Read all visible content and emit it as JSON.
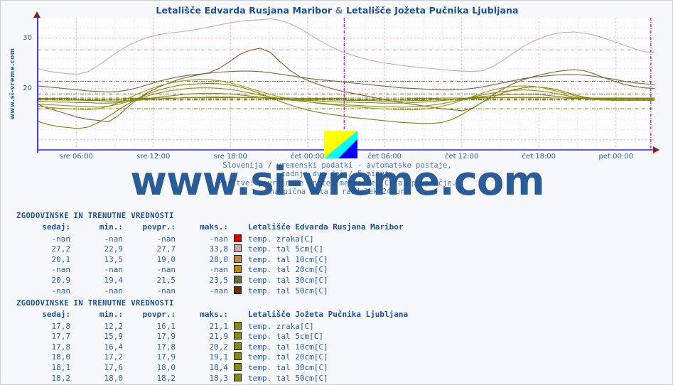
{
  "page": {
    "title": "Letališče Edvarda Rusjana Maribor & Letališče Jožeta Pučnika Ljubljana",
    "title_station_a": "Letališče Edvarda Rusjana Maribor",
    "title_amp": "&",
    "title_station_b": "Letališče Jožeta Pučnika Ljubljana",
    "vertical_url": "www.si-vreme.com",
    "watermark": "www.si-vreme.com",
    "background": "#f6f8fc",
    "accent": "#2a5fa8"
  },
  "caption": {
    "line1": "Slovenija / vremenski podatki - avtomatske postaje,",
    "line2": "zadnja dva dni / 5 minut.",
    "line3": "Meritve: površinske enote: metrične. Črta: povprečje.",
    "line4": "navpična črta - razdelek 24 ur"
  },
  "chart_data": {
    "type": "line",
    "title": "Letališče Edvarda Rusjana Maribor & Letališče Jožeta Pučnika Ljubljana",
    "xlabel": "",
    "ylabel": "",
    "ylim": [
      8,
      34
    ],
    "yticks": [
      20,
      30
    ],
    "ytick_labels": [
      "20",
      "30"
    ],
    "grid": true,
    "legend_position": "below-table",
    "x": [
      "sre 06:00",
      "sre 12:00",
      "sre 18:00",
      "čet 00:00",
      "čet 06:00",
      "čet 12:00",
      "čet 18:00",
      "pet 00:00"
    ],
    "xtick_labels": [
      "sre 06:00",
      "sre 12:00",
      "sre 18:00",
      "čet 00:00",
      "čet 06:00",
      "čet 12:00",
      "čet 18:00",
      "pet 00:00"
    ],
    "day_separator_label": "navpična črta - razdelek 24 ur",
    "series": [
      {
        "name": "Maribor temp. tal 5cm[C]",
        "color": "#c9a9a2",
        "now": null,
        "min": 22.9,
        "avg": 27.7,
        "max": 33.8,
        "values": [
          24.0,
          23.5,
          23.2,
          23.0,
          22.9,
          23.4,
          24.6,
          26.0,
          27.4,
          28.6,
          29.5,
          30.2,
          30.7,
          31.0,
          31.2,
          31.5,
          31.8,
          32.2,
          32.6,
          33.0,
          33.3,
          33.5,
          33.6,
          33.8,
          33.5,
          32.8,
          31.8,
          30.6,
          29.4,
          28.3,
          27.4,
          26.7,
          26.1,
          25.6,
          25.2,
          24.9,
          24.6,
          24.4,
          24.2,
          24.0,
          23.8,
          23.6,
          23.5,
          23.4,
          23.6,
          24.4,
          25.6,
          27.0,
          28.3,
          29.4,
          30.2,
          30.8,
          31.1,
          31.2,
          31.0,
          30.6,
          30.0,
          29.3,
          28.6,
          27.9,
          27.3,
          27.2
        ]
      },
      {
        "name": "Maribor temp. tal 10cm[C]",
        "color": "#8a5a28",
        "now": 20.1,
        "min": 13.5,
        "avg": 19.0,
        "max": 28.0,
        "values": [
          17.0,
          16.2,
          15.6,
          15.0,
          14.4,
          14.0,
          13.8,
          13.5,
          14.8,
          16.6,
          18.2,
          19.4,
          20.4,
          21.2,
          21.9,
          22.4,
          22.8,
          23.2,
          24.1,
          25.4,
          26.8,
          27.6,
          28.0,
          27.2,
          25.3,
          23.6,
          22.3,
          21.4,
          20.7,
          20.1,
          19.6,
          19.2,
          18.8,
          18.4,
          18.0,
          17.6,
          17.3,
          17.0,
          16.7,
          16.4,
          16.1,
          15.9,
          15.7,
          16.2,
          17.4,
          18.8,
          20.0,
          21.0,
          21.8,
          22.4,
          22.9,
          23.3,
          23.6,
          23.8,
          23.6,
          23.0,
          22.2,
          21.5,
          20.9,
          20.5,
          20.2,
          20.1
        ]
      },
      {
        "name": "Maribor temp. tal 30cm[C]",
        "color": "#6b6a3a",
        "now": 20.9,
        "min": 19.4,
        "avg": 21.5,
        "max": 23.5,
        "values": [
          20.6,
          20.4,
          20.2,
          20.0,
          19.8,
          19.6,
          19.5,
          19.4,
          19.5,
          19.8,
          20.3,
          20.9,
          21.5,
          22.0,
          22.4,
          22.7,
          22.9,
          23.1,
          23.3,
          23.4,
          23.5,
          23.5,
          23.4,
          23.2,
          22.9,
          22.6,
          22.3,
          22.0,
          21.8,
          21.6,
          21.4,
          21.2,
          21.0,
          20.8,
          20.6,
          20.4,
          20.2,
          20.1,
          20.0,
          19.9,
          19.8,
          19.8,
          19.9,
          20.1,
          20.4,
          20.8,
          21.2,
          21.6,
          22.0,
          22.3,
          22.5,
          22.7,
          22.8,
          22.8,
          22.7,
          22.5,
          22.2,
          21.9,
          21.5,
          21.2,
          21.0,
          20.9
        ]
      },
      {
        "name": "Ljubljana temp. zraka[C]",
        "color": "#808000",
        "now": 17.8,
        "min": 12.2,
        "avg": 16.1,
        "max": 21.1,
        "values": [
          13.6,
          13.0,
          12.6,
          12.4,
          12.2,
          12.5,
          13.4,
          14.6,
          15.9,
          17.1,
          18.2,
          19.1,
          19.8,
          20.3,
          20.7,
          20.9,
          21.0,
          21.1,
          21.0,
          20.8,
          20.4,
          19.8,
          19.1,
          18.3,
          17.5,
          16.8,
          16.2,
          15.7,
          15.3,
          15.0,
          14.7,
          14.4,
          14.2,
          14.0,
          13.8,
          13.6,
          13.4,
          13.3,
          13.2,
          13.2,
          13.4,
          14.0,
          15.0,
          16.2,
          17.4,
          18.4,
          19.2,
          19.8,
          20.2,
          20.4,
          20.3,
          20.0,
          19.5,
          18.9,
          18.4,
          18.1,
          17.9,
          17.8,
          17.8,
          17.8,
          17.8,
          17.8
        ]
      },
      {
        "name": "Ljubljana temp. tal 5cm[C]",
        "color": "#9a9a10",
        "now": 17.7,
        "min": 15.9,
        "avg": 17.9,
        "max": 21.9,
        "values": [
          16.6,
          16.4,
          16.2,
          16.1,
          16.0,
          15.9,
          16.1,
          16.6,
          17.3,
          18.2,
          19.1,
          19.9,
          20.6,
          21.1,
          21.5,
          21.7,
          21.9,
          21.8,
          21.6,
          21.2,
          20.7,
          20.1,
          19.5,
          18.9,
          18.4,
          18.0,
          17.7,
          17.4,
          17.1,
          16.9,
          16.7,
          16.5,
          16.4,
          16.2,
          16.1,
          16.0,
          15.9,
          15.9,
          16.0,
          16.2,
          16.6,
          17.1,
          17.8,
          18.5,
          19.2,
          19.8,
          20.2,
          20.5,
          20.6,
          20.5,
          20.2,
          19.7,
          19.2,
          18.7,
          18.3,
          18.0,
          17.8,
          17.7,
          17.7,
          17.7,
          17.7,
          17.7
        ]
      },
      {
        "name": "Ljubljana temp. tal 10cm[C]",
        "color": "#8f8f12",
        "now": 17.8,
        "min": 16.4,
        "avg": 17.8,
        "max": 20.2,
        "values": [
          17.0,
          16.9,
          16.8,
          16.7,
          16.6,
          16.5,
          16.4,
          16.6,
          17.0,
          17.5,
          18.1,
          18.7,
          19.2,
          19.6,
          19.9,
          20.1,
          20.2,
          20.2,
          20.1,
          19.9,
          19.6,
          19.2,
          18.8,
          18.4,
          18.1,
          17.8,
          17.6,
          17.4,
          17.2,
          17.0,
          16.9,
          16.8,
          16.7,
          16.6,
          16.5,
          16.5,
          16.4,
          16.5,
          16.6,
          16.8,
          17.1,
          17.5,
          17.9,
          18.4,
          18.8,
          19.2,
          19.5,
          19.7,
          19.8,
          19.7,
          19.5,
          19.2,
          18.8,
          18.4,
          18.1,
          17.9,
          17.8,
          17.8,
          17.8,
          17.8,
          17.8,
          17.8
        ]
      },
      {
        "name": "Ljubljana temp. tal 20cm[C]",
        "color": "#8a8a18",
        "now": 18.0,
        "min": 17.2,
        "avg": 17.9,
        "max": 19.1,
        "values": [
          17.6,
          17.5,
          17.4,
          17.4,
          17.3,
          17.3,
          17.2,
          17.2,
          17.3,
          17.5,
          17.8,
          18.1,
          18.4,
          18.6,
          18.8,
          19.0,
          19.1,
          19.1,
          19.1,
          19.0,
          18.8,
          18.6,
          18.4,
          18.2,
          18.0,
          17.9,
          17.8,
          17.7,
          17.6,
          17.5,
          17.4,
          17.4,
          17.3,
          17.3,
          17.2,
          17.2,
          17.2,
          17.3,
          17.4,
          17.5,
          17.7,
          17.9,
          18.1,
          18.3,
          18.5,
          18.7,
          18.8,
          18.9,
          18.9,
          18.9,
          18.8,
          18.6,
          18.4,
          18.2,
          18.1,
          18.0,
          18.0,
          18.0,
          18.0,
          18.0,
          18.0,
          18.0
        ]
      },
      {
        "name": "Ljubljana temp. tal 30cm[C]",
        "color": "#858512",
        "now": 18.1,
        "min": 17.6,
        "avg": 18.0,
        "max": 18.4,
        "values": [
          17.9,
          17.9,
          17.8,
          17.8,
          17.8,
          17.7,
          17.7,
          17.6,
          17.6,
          17.7,
          17.8,
          17.9,
          18.0,
          18.1,
          18.2,
          18.3,
          18.3,
          18.4,
          18.4,
          18.4,
          18.3,
          18.3,
          18.2,
          18.1,
          18.1,
          18.0,
          18.0,
          17.9,
          17.9,
          17.8,
          17.8,
          17.7,
          17.7,
          17.7,
          17.6,
          17.6,
          17.6,
          17.7,
          17.7,
          17.8,
          17.9,
          17.9,
          18.0,
          18.1,
          18.2,
          18.2,
          18.3,
          18.3,
          18.3,
          18.3,
          18.3,
          18.2,
          18.2,
          18.1,
          18.1,
          18.1,
          18.1,
          18.1,
          18.1,
          18.1,
          18.1,
          18.1
        ]
      },
      {
        "name": "Ljubljana temp. tal 50cm[C]",
        "color": "#7d7d0e",
        "now": 18.2,
        "min": 18.0,
        "avg": 18.2,
        "max": 18.3,
        "values": [
          18.1,
          18.1,
          18.1,
          18.1,
          18.0,
          18.0,
          18.0,
          18.0,
          18.0,
          18.1,
          18.1,
          18.1,
          18.2,
          18.2,
          18.2,
          18.3,
          18.3,
          18.3,
          18.3,
          18.3,
          18.3,
          18.3,
          18.2,
          18.2,
          18.2,
          18.2,
          18.1,
          18.1,
          18.1,
          18.1,
          18.1,
          18.0,
          18.0,
          18.0,
          18.0,
          18.0,
          18.0,
          18.1,
          18.1,
          18.1,
          18.2,
          18.2,
          18.2,
          18.2,
          18.3,
          18.3,
          18.3,
          18.3,
          18.3,
          18.3,
          18.3,
          18.2,
          18.2,
          18.2,
          18.2,
          18.2,
          18.2,
          18.2,
          18.2,
          18.2,
          18.2,
          18.2
        ]
      }
    ]
  },
  "tables": [
    {
      "caption": "ZGODOVINSKE IN TRENUTNE VREDNOSTI",
      "headers": {
        "now": "sedaj:",
        "min": "min.:",
        "avg": "povpr.:",
        "max": "maks.:",
        "station": "Letališče Edvarda Rusjana Maribor"
      },
      "rows": [
        {
          "now": "-nan",
          "min": "-nan",
          "avg": "-nan",
          "max": "-nan",
          "color": "#e00000",
          "label": "temp. zraka[C]"
        },
        {
          "now": "27,2",
          "min": "22,9",
          "avg": "27,7",
          "max": "33,8",
          "color": "#c9a9a2",
          "label": "temp. tal  5cm[C]"
        },
        {
          "now": "20,1",
          "min": "13,5",
          "avg": "19,0",
          "max": "28,0",
          "color": "#c08a3e",
          "label": "temp. tal 10cm[C]"
        },
        {
          "now": "-nan",
          "min": "-nan",
          "avg": "-nan",
          "max": "-nan",
          "color": "#b8860b",
          "label": "temp. tal 20cm[C]"
        },
        {
          "now": "20,9",
          "min": "19,4",
          "avg": "21,5",
          "max": "23,5",
          "color": "#6b6a3a",
          "label": "temp. tal 30cm[C]"
        },
        {
          "now": "-nan",
          "min": "-nan",
          "avg": "-nan",
          "max": "-nan",
          "color": "#6b3005",
          "label": "temp. tal 50cm[C]"
        }
      ]
    },
    {
      "caption": "ZGODOVINSKE IN TRENUTNE VREDNOSTI",
      "headers": {
        "now": "sedaj:",
        "min": "min.:",
        "avg": "povpr.:",
        "max": "maks.:",
        "station": "Letališče Jožeta Pučnika Ljubljana"
      },
      "rows": [
        {
          "now": "17,8",
          "min": "12,2",
          "avg": "16,1",
          "max": "21,1",
          "color": "#8a8a0a",
          "label": "temp. zraka[C]"
        },
        {
          "now": "17,7",
          "min": "15,9",
          "avg": "17,9",
          "max": "21,9",
          "color": "#8a8a0a",
          "label": "temp. tal  5cm[C]"
        },
        {
          "now": "17,8",
          "min": "16,4",
          "avg": "17,8",
          "max": "20,2",
          "color": "#8a8a0a",
          "label": "temp. tal 10cm[C]"
        },
        {
          "now": "18,0",
          "min": "17,2",
          "avg": "17,9",
          "max": "19,1",
          "color": "#8a8a0a",
          "label": "temp. tal 20cm[C]"
        },
        {
          "now": "18,1",
          "min": "17,6",
          "avg": "18,0",
          "max": "18,4",
          "color": "#8a8a0a",
          "label": "temp. tal 30cm[C]"
        },
        {
          "now": "18,2",
          "min": "18,0",
          "avg": "18,2",
          "max": "18,3",
          "color": "#8a8a0a",
          "label": "temp. tal 50cm[C]"
        }
      ]
    }
  ]
}
